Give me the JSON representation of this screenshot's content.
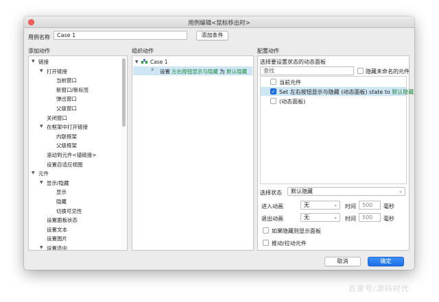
{
  "window": {
    "title": "用例编辑<鼠标移出时>"
  },
  "case_row": {
    "label": "用例名称",
    "value": "Case 1",
    "add_condition": "添加条件"
  },
  "sections": {
    "add_action": "添加动作",
    "organize_action": "组织动作",
    "configure_action": "配置动作"
  },
  "add_action_tree": [
    {
      "label": "链接",
      "level": 0,
      "expanded": true
    },
    {
      "label": "打开链接",
      "level": 1,
      "expanded": true
    },
    {
      "label": "当前窗口",
      "level": 2
    },
    {
      "label": "新窗口/新标签",
      "level": 2
    },
    {
      "label": "弹出窗口",
      "level": 2
    },
    {
      "label": "父级窗口",
      "level": 2
    },
    {
      "label": "关闭窗口",
      "level": 1
    },
    {
      "label": "在框架中打开链接",
      "level": 1,
      "expanded": true
    },
    {
      "label": "内联框架",
      "level": 2
    },
    {
      "label": "父级框架",
      "level": 2
    },
    {
      "label": "滚动到元件<锚链接>",
      "level": 1
    },
    {
      "label": "设置自适应视图",
      "level": 1
    },
    {
      "label": "元件",
      "level": 0,
      "expanded": true
    },
    {
      "label": "显示/隐藏",
      "level": 1,
      "expanded": true
    },
    {
      "label": "显示",
      "level": 2
    },
    {
      "label": "隐藏",
      "level": 2
    },
    {
      "label": "切换可见性",
      "level": 2
    },
    {
      "label": "设置面板状态",
      "level": 1
    },
    {
      "label": "设置文本",
      "level": 1
    },
    {
      "label": "设置图片",
      "level": 1
    },
    {
      "label": "设置选中",
      "level": 1,
      "expanded": true
    }
  ],
  "organize": {
    "case_label": "Case 1",
    "action_prefix": "设置",
    "action_target": "左右按钮显示与隐藏",
    "action_mid": "为",
    "action_state": "默认隐藏"
  },
  "configure": {
    "panel_heading": "选择要设置状态的动态面板",
    "search_placeholder": "查找",
    "hide_unnamed": "隐藏未命名的元件",
    "items": [
      {
        "label": "当前元件",
        "checked": false
      },
      {
        "label_prefix": "Set",
        "label_target": "左右按钮显示与隐藏 (动态面板)",
        "label_mid": "state to",
        "label_state": "默认隐藏",
        "checked": true
      },
      {
        "label": "(动态面板)",
        "checked": false
      }
    ],
    "select_state_label": "选择状态",
    "select_state_value": "默认隐藏",
    "enter_anim_label": "进入动画",
    "enter_anim_value": "无",
    "enter_time_label": "时间",
    "enter_time_value": "500",
    "enter_unit": "毫秒",
    "exit_anim_label": "退出动画",
    "exit_anim_value": "无",
    "exit_time_label": "时间",
    "exit_time_value": "500",
    "exit_unit": "毫秒",
    "show_if_hidden": "如果隐藏则显示面板",
    "push_pull": "推动/拉动元件"
  },
  "footer": {
    "cancel": "取消",
    "ok": "确定"
  },
  "watermark": "百家号/源码时代",
  "colors": {
    "accent": "#1f6fe8",
    "green_text": "#1e8a3e",
    "selected_row": "#cfe6f5"
  }
}
